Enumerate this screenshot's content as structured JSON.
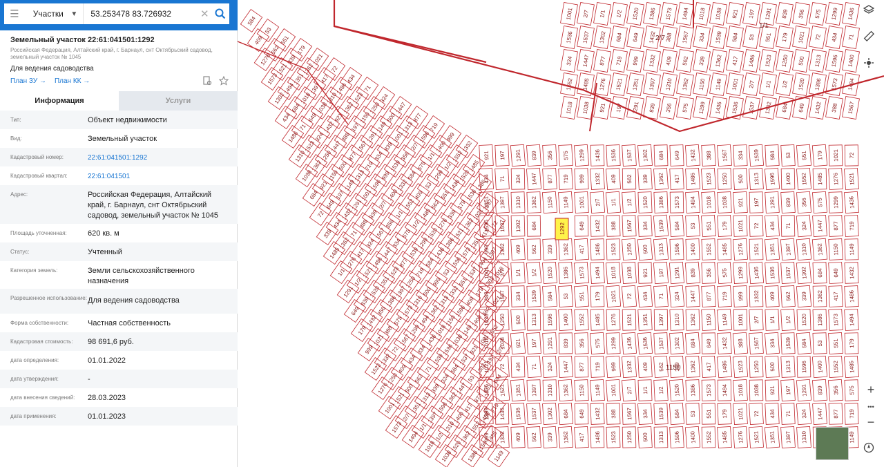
{
  "search": {
    "type_label": "Участки",
    "coords_value": "53.253478 83.726932"
  },
  "parcel": {
    "title": "Земельный участок 22:61:041501:1292",
    "address_line1": "Российская Федерация, Алтайский край, г. Барнаул, снт Октябрьский садовод,",
    "address_line2": "земельный участок № 1045",
    "use": "Для ведения садоводства",
    "plan_zu": "План ЗУ →",
    "plan_kk": "План КК →"
  },
  "tabs": {
    "info": "Информация",
    "services": "Услуги"
  },
  "rows": [
    {
      "label": "Тип:",
      "value": "Объект недвижимости"
    },
    {
      "label": "Вид:",
      "value": "Земельный участок"
    },
    {
      "label": "Кадастровый номер:",
      "value": "22:61:041501:1292"
    },
    {
      "label": "Кадастровый квартал:",
      "value": "22:61:041501"
    },
    {
      "label": "Адрес:",
      "value": "Российская Федерация, Алтайский край, г. Барнаул, снт Октябрьский садовод, земельный участок № 1045"
    },
    {
      "label": "Площадь уточненная:",
      "value": "620 кв. м"
    },
    {
      "label": "Статус:",
      "value": "Учтенный"
    },
    {
      "label": "Категория земель:",
      "value": "Земли сельскохозяйственного назначения"
    },
    {
      "label": "Разрешенное использование:",
      "value": "Для ведения садоводства"
    },
    {
      "label": "Форма собственности:",
      "value": "Частная собственность"
    },
    {
      "label": "Кадастровая стоимость:",
      "value": "98 691,6 руб."
    },
    {
      "label": "дата определения:",
      "value": "01.01.2022"
    },
    {
      "label": "дата утверждения:",
      "value": "-"
    },
    {
      "label": "дата внесения сведений:",
      "value": "28.03.2023"
    },
    {
      "label": "дата применения:",
      "value": "01.01.2023"
    }
  ],
  "map": {
    "line_color": "#c0272d",
    "highlight_color": "#fff34a",
    "selected_label": "1292",
    "parcel_numbers": [
      "584",
      "53",
      "551",
      "179",
      "1021",
      "72",
      "434",
      "71",
      "324",
      "1447",
      "877",
      "719",
      "999",
      "1332",
      "409",
      "562",
      "339",
      "1362",
      "417",
      "1486",
      "1523",
      "1250",
      "500",
      "1313",
      "1596",
      "1400",
      "1552",
      "1485",
      "1276",
      "1521",
      "1351",
      "1397",
      "1310",
      "1362",
      "1150",
      "1149",
      "1001",
      "2/7",
      "1/1",
      "1/2",
      "1520",
      "1386",
      "1573",
      "1494",
      "1018",
      "1038",
      "921",
      "197",
      "1291",
      "839",
      "356",
      "575",
      "1299",
      "1436",
      "1536",
      "1537",
      "1302",
      "684",
      "649",
      "1432",
      "388",
      "1567",
      "334",
      "1539"
    ],
    "label_2_7": "2/7",
    "label_1_1": "1/1",
    "label_1150": "1150"
  },
  "map_tools": {
    "layers_icon": "layers-icon",
    "ruler_icon": "ruler-icon",
    "locate_icon": "locate-icon",
    "zoom_in": "+",
    "zoom_out": "−",
    "more": "•••",
    "compass_icon": "compass-icon"
  }
}
